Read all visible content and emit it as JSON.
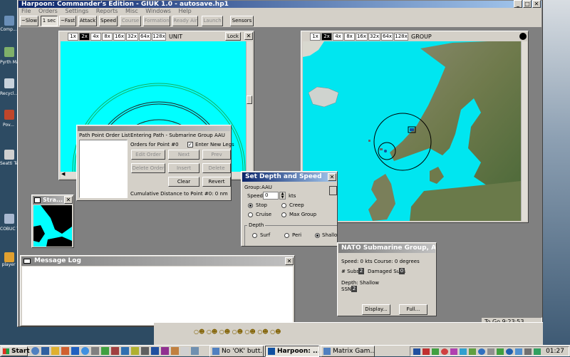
{
  "app": {
    "title": "Harpoon: Commander's Edition - GIUK 1.0 - autosave.hp1",
    "menu": [
      "File",
      "Orders",
      "Settings",
      "Reports",
      "Misc",
      "Windows",
      "Help"
    ]
  },
  "toolbar": {
    "buttons": [
      {
        "label": "~Slow",
        "enabled": true
      },
      {
        "label": "1 sec",
        "enabled": true,
        "pressed": true
      },
      {
        "label": "~Fast",
        "enabled": true
      },
      {
        "label": "Attack",
        "enabled": true
      },
      {
        "label": "Speed",
        "enabled": true
      },
      {
        "label": "Course",
        "enabled": false
      },
      {
        "label": "Formation",
        "enabled": false
      },
      {
        "label": "Ready Air",
        "enabled": false
      },
      {
        "label": "Launch",
        "enabled": false
      },
      {
        "label": "Sensors",
        "enabled": true
      }
    ]
  },
  "zoom_levels": [
    "1x",
    "2x",
    "4x",
    "8x",
    "16x",
    "32x",
    "64x",
    "128x"
  ],
  "unit_window": {
    "title": "UNIT",
    "lock_label": "Lock",
    "selected_zoom": "2x"
  },
  "group_window": {
    "title": "GROUP",
    "selected_zoom": "2x"
  },
  "path_window": {
    "list_title": "Path Point Order List",
    "entering": "Entering Path - Submarine Group AAU",
    "orders_for": "Orders for Point #0",
    "enter_new_legs": "Enter New Legs",
    "enter_new_legs_checked": true,
    "buttons": {
      "edit": "Edit Order",
      "next": "Next",
      "prev": "Prev",
      "delete_order": "Delete Order",
      "insert": "Insert",
      "delete": "Delete",
      "clear": "Clear",
      "revert": "Revert"
    },
    "cumulative": "Cumulative Distance to Point #0: 0 nm"
  },
  "depth_speed": {
    "title": "Set Depth and Speed",
    "group_label": "Group:",
    "group_value": "AAU",
    "speed_label": "Speed",
    "speed_value": "0",
    "speed_unit": "kts",
    "speed_options": [
      "Stop",
      "Creep",
      "Cruise",
      "Max Group"
    ],
    "selected_speed": "Stop",
    "depth_label": "Depth",
    "depth_options": [
      "Surf",
      "Peri",
      "Shallow"
    ],
    "selected_depth": "Shallow"
  },
  "strat_window": {
    "title": "Stra..."
  },
  "message_log": {
    "title": "Message Log"
  },
  "nato_panel": {
    "title": "NATO Submarine Group, A...",
    "speed_line": "Speed: 0 kts  Course: 0 degrees",
    "subs_label": "# Subs",
    "subs_count": "2",
    "damaged_label": "Damaged Subs",
    "damaged_count": "0",
    "depth_line": "Depth: Shallow",
    "ssn_label": "SSN",
    "ssn_count": "2",
    "display_btn": "Display...",
    "full_btn": "Full..."
  },
  "status": {
    "to_go": "To Go 9:23:53"
  },
  "taskbar": {
    "start": "Start",
    "tasks": [
      "No 'OK' butt...",
      "Harpoon: ...",
      "Matrix Gam..."
    ],
    "active_task": 1,
    "clock": "01:27"
  },
  "desktop_icons": [
    "Comp...",
    "Pyrth Ma...",
    "Recycl...",
    "Pov...",
    "Seatti Techn...",
    "COBUC Tech...",
    "player"
  ]
}
